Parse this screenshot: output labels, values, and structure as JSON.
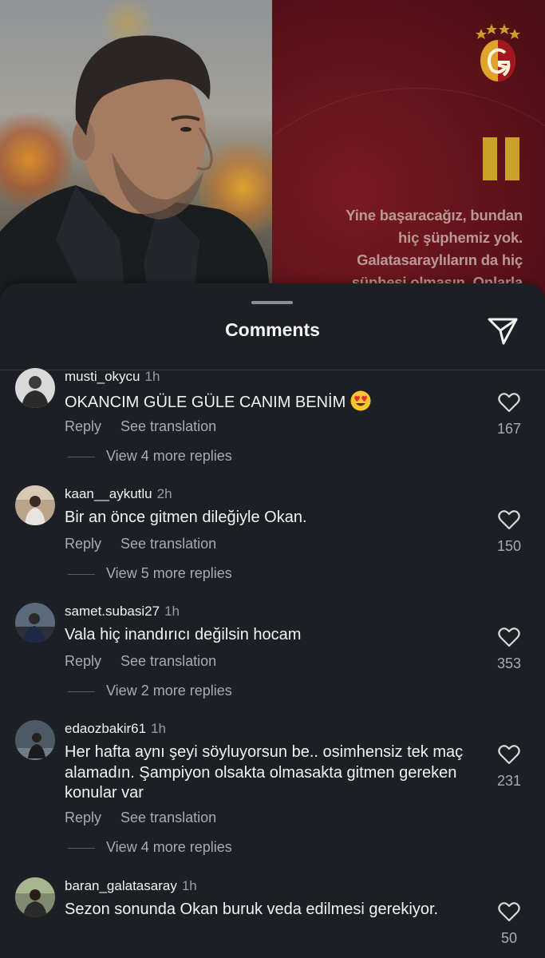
{
  "post": {
    "quote": [
      "Yine başaracağız, bundan",
      "hiç şüphemiz yok.",
      "Galatasaraylıların da hiç",
      "şüphesi olmasın. Onlarla"
    ]
  },
  "sheet": {
    "title": "Comments",
    "share_icon": "paper-plane-icon"
  },
  "labels": {
    "reply": "Reply",
    "see_translation": "See translation"
  },
  "comments": [
    {
      "username": "musti_okycu",
      "time": "1h",
      "text": "OKANCIM GÜLE GÜLE CANIM BENİM",
      "emoji": "heart-eyes-emoji",
      "likes": "167",
      "replies": "View 4 more replies"
    },
    {
      "username": "kaan__aykutlu",
      "time": "2h",
      "text": "Bir an önce gitmen dileğiyle Okan.",
      "likes": "150",
      "replies": "View 5 more replies"
    },
    {
      "username": "samet.subasi27",
      "time": "1h",
      "text": "Vala hiç inandırıcı değilsin hocam",
      "likes": "353",
      "replies": "View 2 more replies"
    },
    {
      "username": "edaozbakir61",
      "time": "1h",
      "text": "Her hafta aynı şeyi söyluyorsun be.. osimhensiz tek maç alamadın. Şampiyon olsakta olmasakta gitmen gereken konular var",
      "likes": "231",
      "replies": "View 4 more replies"
    },
    {
      "username": "baran_galatasaray",
      "time": "1h",
      "text": "Sezon sonunda Okan buruk veda edilmesi gerekiyor.",
      "likes": "50"
    }
  ],
  "colors": {
    "sheet_bg": "#1c1f24",
    "panel_red": "#5e1219",
    "gold": "#c9a227"
  }
}
